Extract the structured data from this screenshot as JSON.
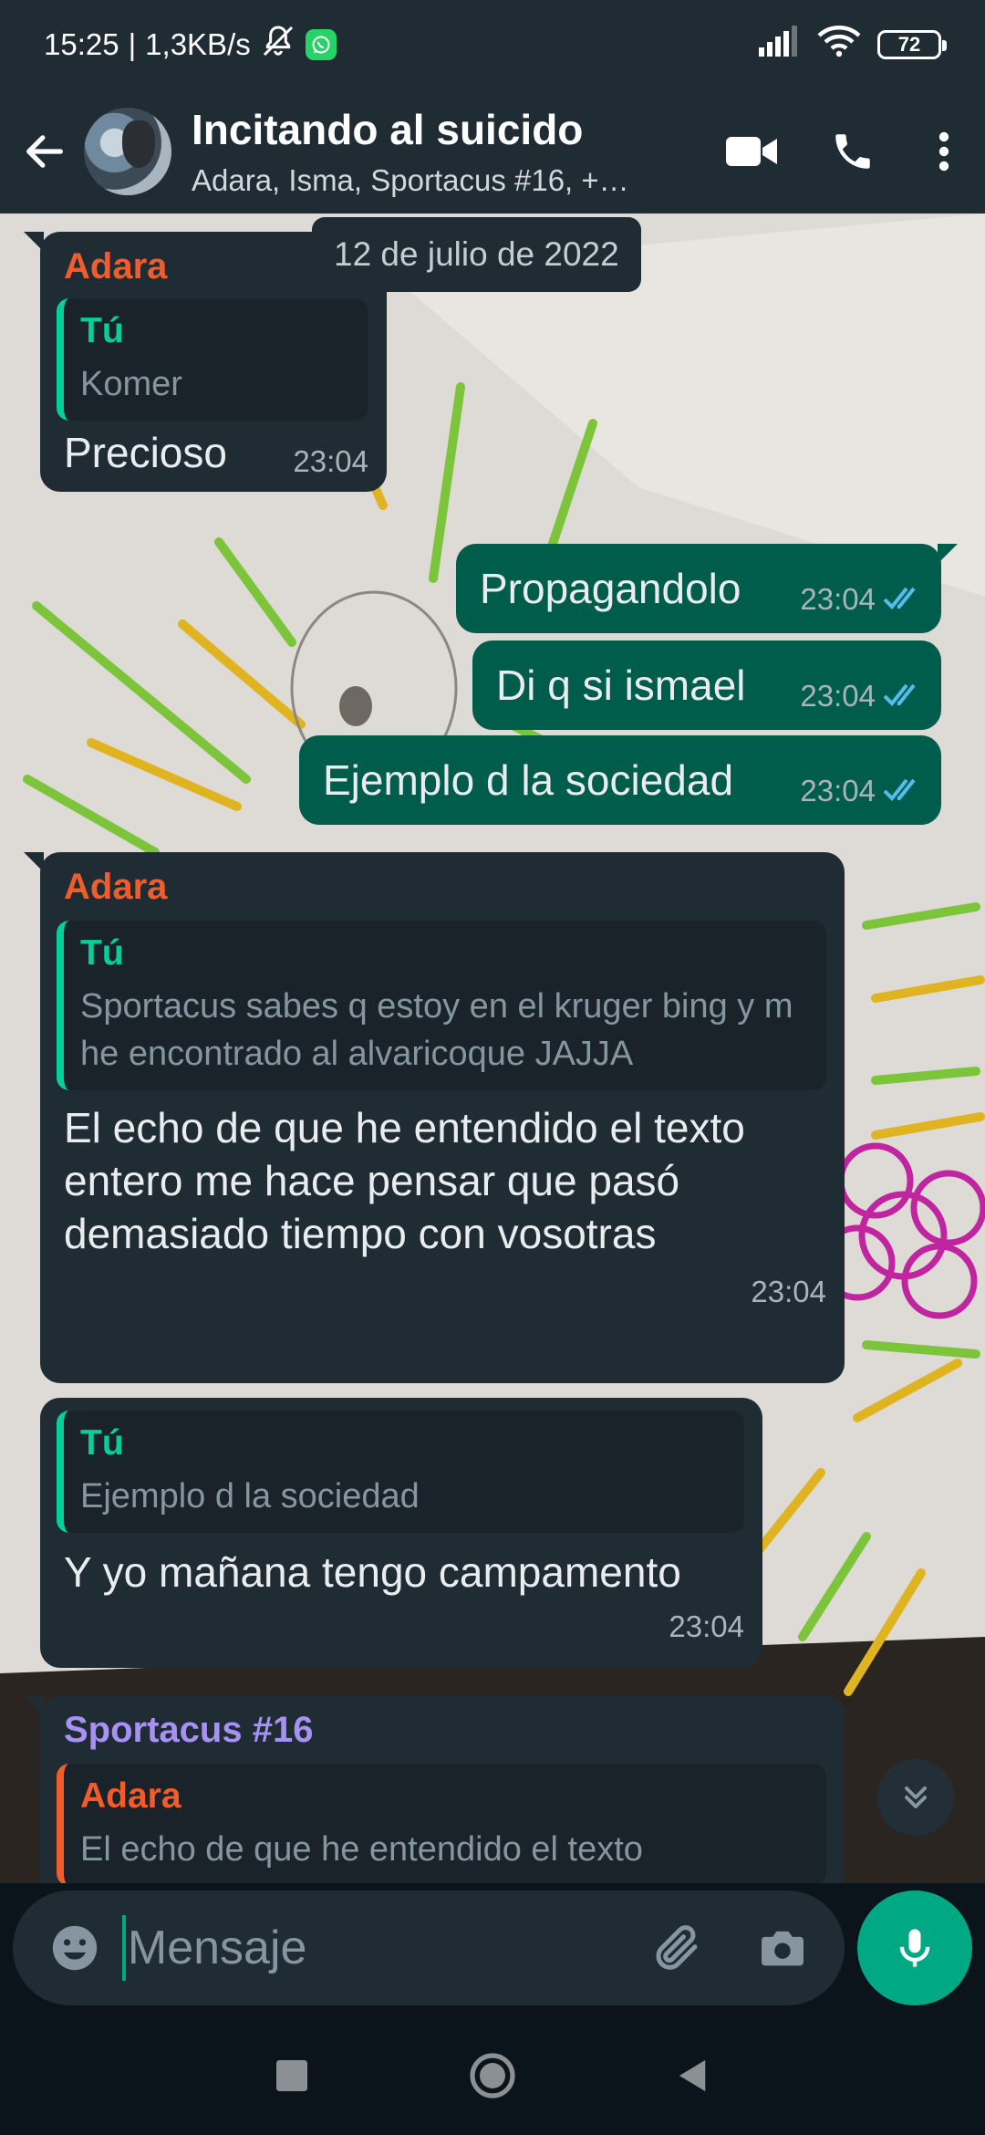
{
  "status_bar": {
    "time": "15:25",
    "separator": "|",
    "network_speed": "1,3KB/s",
    "battery": "72",
    "icons": [
      "mute-bell-icon",
      "whatsapp-notification-icon",
      "signal-icon",
      "wifi-icon",
      "battery-icon"
    ]
  },
  "header": {
    "title": "Incitando al suicido",
    "members": "Adara, Isma, Sportacus #16, +…",
    "icons": [
      "back-arrow-icon",
      "video-call-icon",
      "voice-call-icon",
      "more-vertical-icon"
    ]
  },
  "chat": {
    "date_chip": "12 de julio de 2022",
    "messages": [
      {
        "direction": "in",
        "sender": "Adara",
        "sender_color": "#f15c2b",
        "quote_author": "Tú",
        "quote_text": "Komer",
        "text": "Precioso",
        "time": "23:04"
      },
      {
        "direction": "out",
        "text": "Propagandolo",
        "time": "23:04",
        "status": "read"
      },
      {
        "direction": "out",
        "text": "Di q si ismael",
        "time": "23:04",
        "status": "read"
      },
      {
        "direction": "out",
        "text": "Ejemplo d la sociedad",
        "time": "23:04",
        "status": "read"
      },
      {
        "direction": "in",
        "sender": "Adara",
        "sender_color": "#f15c2b",
        "quote_author": "Tú",
        "quote_text": "Sportacus sabes q estoy en el kruger bing y m he encontrado al alvaricoque JAJJA",
        "text": "El echo de que he entendido el texto entero me hace pensar que pasó demasiado tiempo con vosotras",
        "time": "23:04"
      },
      {
        "direction": "in",
        "quote_author": "Tú",
        "quote_text": "Ejemplo d la sociedad",
        "text": "Y yo mañana tengo campamento",
        "time": "23:04"
      },
      {
        "direction": "in",
        "sender": "Sportacus #16",
        "sender_color": "#a791f5",
        "quote_author": "Adara",
        "quote_author_color": "#f15c2b",
        "quote_text": "El echo de que he entendido el texto"
      }
    ]
  },
  "composer": {
    "placeholder": "Mensaje",
    "icons": [
      "emoji-icon",
      "attach-icon",
      "camera-icon",
      "mic-icon"
    ]
  },
  "colors": {
    "header_bg": "#1f2c34",
    "incoming_bubble": "#202c33",
    "outgoing_bubble": "#005c4b",
    "accent": "#00a884",
    "read_ticks": "#53bdeb"
  },
  "navbar": {
    "icons": [
      "recents-square-icon",
      "home-circle-icon",
      "back-triangle-icon"
    ]
  }
}
